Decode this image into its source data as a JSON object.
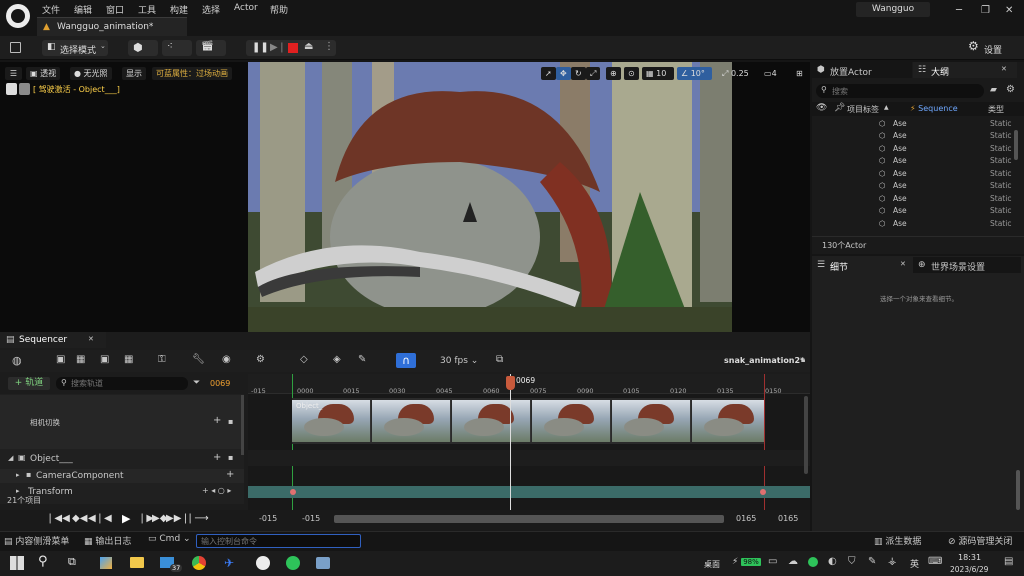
{
  "titlebar": {
    "menus": [
      "文件",
      "编辑",
      "窗口",
      "工具",
      "构建",
      "选择",
      "Actor",
      "帮助"
    ],
    "doc_tab": "Wangguo_animation*",
    "user": "Wangguo"
  },
  "toolbar": {
    "mode_label": "选择模式",
    "settings_label": "设置"
  },
  "viewport": {
    "perspective_label": "透视",
    "lighting_label": "无光照",
    "show_label": "显示",
    "visibility_label": "可蓝属性：过场动画",
    "pilot_label": "[ 驾驶激活 - Object___]",
    "grid_value": "10",
    "angle_value": "10°",
    "scale_value": "0.25",
    "camera_speed": "4"
  },
  "outliner": {
    "tab_place": "放置Actor",
    "tab_outliner": "大纲",
    "search_placeholder": "搜索",
    "col_label": "项目标签",
    "col_sequence": "Sequence",
    "col_type": "类型",
    "rows": [
      {
        "label": "Ase",
        "type": "Static"
      },
      {
        "label": "Ase",
        "type": "Static"
      },
      {
        "label": "Ase",
        "type": "Static"
      },
      {
        "label": "Ase",
        "type": "Static"
      },
      {
        "label": "Ase",
        "type": "Static"
      },
      {
        "label": "Ase",
        "type": "Static"
      },
      {
        "label": "Ase",
        "type": "Static"
      },
      {
        "label": "Ase",
        "type": "Static"
      },
      {
        "label": "Ase",
        "type": "Static"
      }
    ],
    "count": "130个Actor"
  },
  "details": {
    "tab_details": "细节",
    "tab_world": "世界场景设置",
    "empty_hint": "选择一个对象来查看细节。"
  },
  "sequencer": {
    "tab": "Sequencer",
    "fps": "30 fps",
    "sequence_name": "snak_animation2*",
    "add_track": "+ 轨道",
    "search_placeholder": "搜索轨道",
    "current_frame": "0069",
    "playhead_label": "0069",
    "ticks": [
      "-015",
      "0000",
      "0015",
      "0030",
      "0045",
      "0060",
      "0075",
      "0090",
      "0105",
      "0120",
      "0135",
      "0150"
    ],
    "tracks": {
      "camera_cuts": "相机切换",
      "object": "Object___",
      "camera_component": "CameraComponent",
      "transform": "Transform"
    },
    "item_count": "21个项目",
    "range_start_a": "-015",
    "range_start_b": "-015",
    "range_end_a": "0165",
    "range_end_b": "0165",
    "thumb_label": "Object_"
  },
  "status": {
    "content_drawer": "内容侧滑菜单",
    "output_log": "输出日志",
    "cmd": "Cmd",
    "console_placeholder": "输入控制台命令",
    "derived_data": "派生数据",
    "source_control": "源码管理关闭"
  },
  "taskbar": {
    "badge": "37",
    "desktop": "桌面",
    "battery": "98%",
    "ime": "英",
    "time": "18:31",
    "date": "2023/6/29"
  }
}
